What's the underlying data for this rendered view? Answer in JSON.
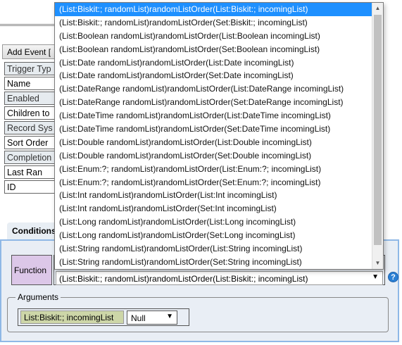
{
  "toolbar": {
    "add_event_label": "Add Event ["
  },
  "properties": [
    {
      "label": "Trigger Typ",
      "style": "grey"
    },
    {
      "label": "Name",
      "style": "white"
    },
    {
      "label": "Enabled",
      "style": "grey"
    },
    {
      "label": "Children to",
      "style": "white"
    },
    {
      "label": "Record Sys",
      "style": "grey"
    },
    {
      "label": "Sort Order",
      "style": "white"
    },
    {
      "label": "Completion",
      "style": "grey"
    },
    {
      "label": "Last Ran",
      "style": "white"
    },
    {
      "label": "ID",
      "style": "white"
    }
  ],
  "tabs": {
    "conditions_label": "Conditions"
  },
  "function": {
    "label": "Function",
    "selected_value": "(List:Biskit:; randomList)randomListOrder(List:Biskit:; incomingList)",
    "help_icon_text": "?"
  },
  "arguments": {
    "legend": "Arguments",
    "arg_label": "List:Biskit:; incomingList",
    "arg_value": "Null"
  },
  "dropdown": {
    "items": [
      "(List:Biskit:; randomList)randomListOrder(List:Biskit:; incomingList)",
      "(List:Biskit:; randomList)randomListOrder(Set:Biskit:; incomingList)",
      "(List:Boolean randomList)randomListOrder(List:Boolean incomingList)",
      "(List:Boolean randomList)randomListOrder(Set:Boolean incomingList)",
      "(List:Date randomList)randomListOrder(List:Date incomingList)",
      "(List:Date randomList)randomListOrder(Set:Date incomingList)",
      "(List:DateRange randomList)randomListOrder(List:DateRange incomingList)",
      "(List:DateRange randomList)randomListOrder(Set:DateRange incomingList)",
      "(List:DateTime randomList)randomListOrder(List:DateTime incomingList)",
      "(List:DateTime randomList)randomListOrder(Set:DateTime incomingList)",
      "(List:Double randomList)randomListOrder(List:Double incomingList)",
      "(List:Double randomList)randomListOrder(Set:Double incomingList)",
      "(List:Enum:?; randomList)randomListOrder(List:Enum:?; incomingList)",
      "(List:Enum:?; randomList)randomListOrder(Set:Enum:?; incomingList)",
      "(List:Int randomList)randomListOrder(List:Int incomingList)",
      "(List:Int randomList)randomListOrder(Set:Int incomingList)",
      "(List:Long randomList)randomListOrder(List:Long incomingList)",
      "(List:Long randomList)randomListOrder(Set:Long incomingList)",
      "(List:String randomList)randomListOrder(List:String incomingList)",
      "(List:String randomList)randomListOrder(Set:String incomingList)"
    ],
    "selected_index": 0
  },
  "icons": {
    "select_arrow": "▼",
    "scroll_up": "▲",
    "scroll_down": "▼"
  }
}
